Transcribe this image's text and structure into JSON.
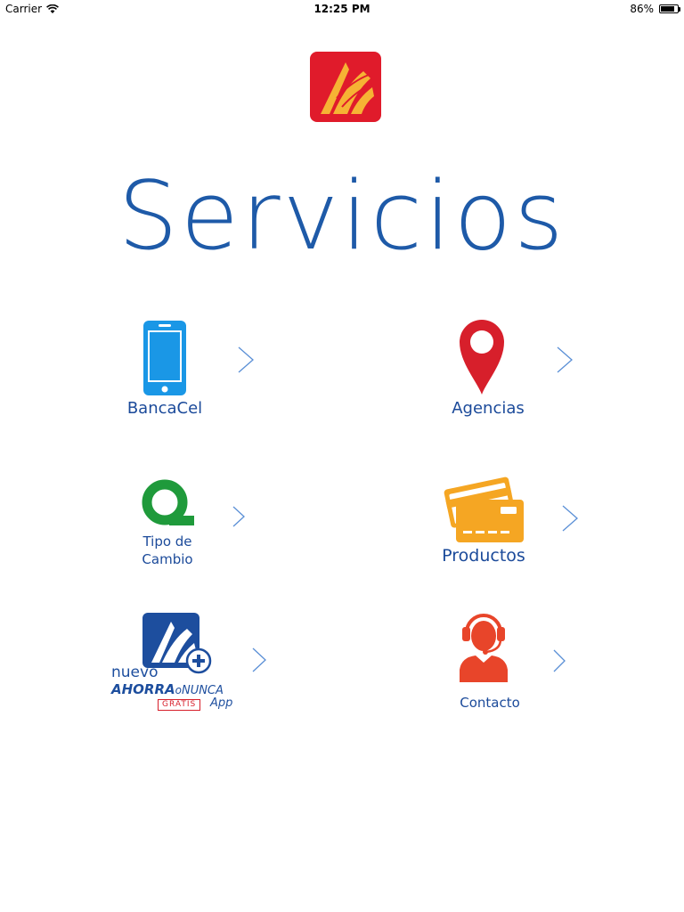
{
  "status_bar": {
    "carrier": "Carrier",
    "time": "12:25 PM",
    "battery_percent": "86%",
    "battery_level": 0.86
  },
  "header": {
    "title": "Servicios"
  },
  "services": [
    {
      "id": "bancacel",
      "label": "BancaCel",
      "icon": "smartphone-icon",
      "color": "#1a97e6"
    },
    {
      "id": "agencias",
      "label": "Agencias",
      "icon": "map-pin-icon",
      "color": "#d71f2b"
    },
    {
      "id": "tipo_cambio",
      "label_lines": [
        "Tipo de",
        "Cambio"
      ],
      "icon": "exchange-rate-q-icon",
      "color": "#1f9a3b"
    },
    {
      "id": "productos",
      "label": "Productos",
      "icon": "credit-cards-icon",
      "color": "#f5a623"
    },
    {
      "id": "ahorra",
      "app_logo": {
        "line1": "nuevo",
        "brand_bold": "AHORRA",
        "brand_small_1": "o",
        "brand_small_2": "NUNCA",
        "badge": "GRATIS",
        "suffix": "App"
      },
      "icon": "ahorra-app-logo",
      "color": "#1d4e9e"
    },
    {
      "id": "contacto",
      "label": "Contacto",
      "icon": "support-agent-icon",
      "color": "#e8452a"
    }
  ],
  "colors": {
    "title": "#1e5aa8",
    "label": "#1b4a9a",
    "chevron": "#5a8fd6",
    "logo_red": "#e01b2b",
    "logo_gold": "#f6b334"
  }
}
